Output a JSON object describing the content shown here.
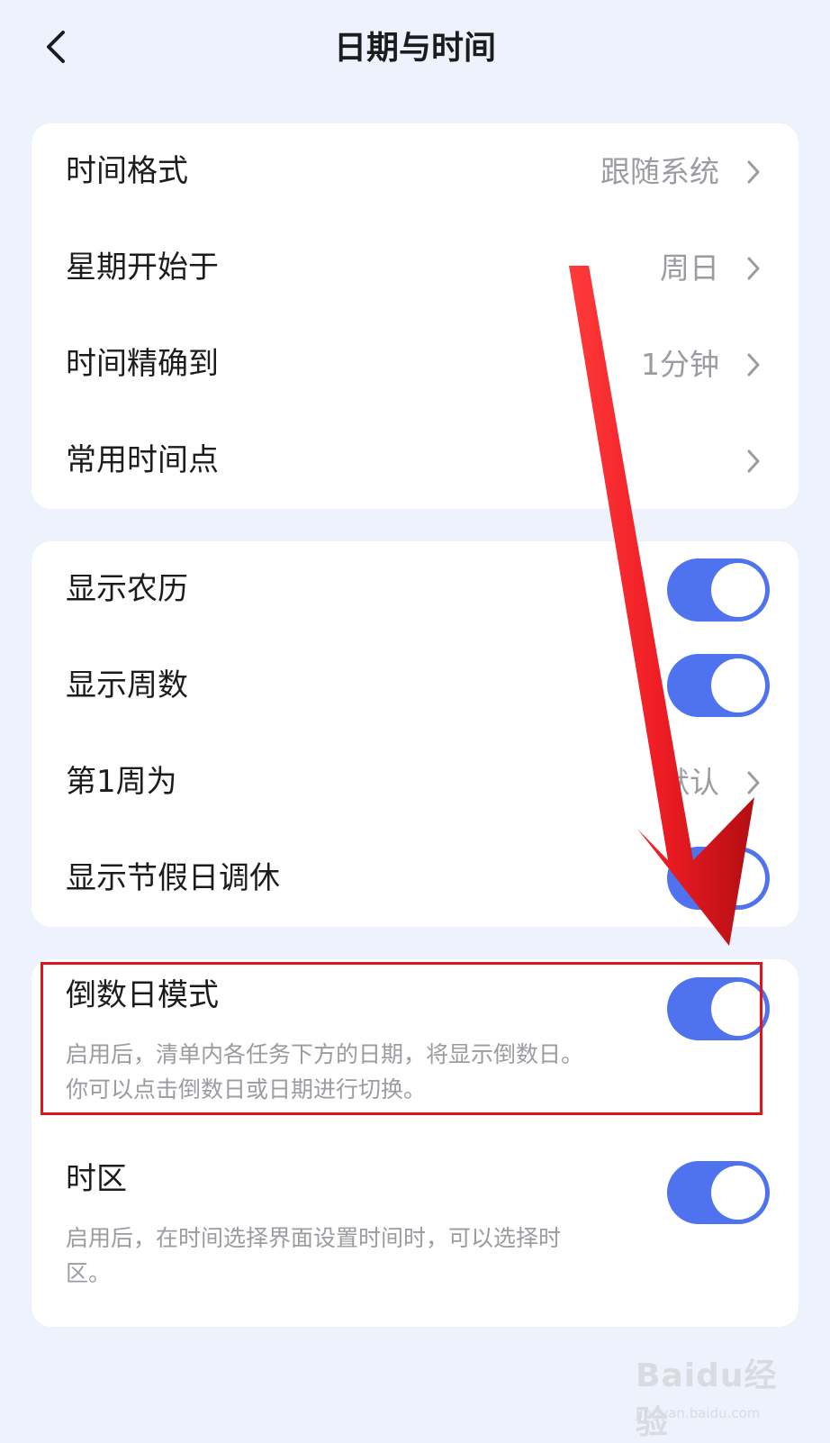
{
  "header": {
    "title": "日期与时间"
  },
  "card1": {
    "items": [
      {
        "label": "时间格式",
        "value": "跟随系统"
      },
      {
        "label": "星期开始于",
        "value": "周日"
      },
      {
        "label": "时间精确到",
        "value": "1分钟"
      },
      {
        "label": "常用时间点",
        "value": ""
      }
    ]
  },
  "card2": {
    "items": [
      {
        "label": "显示农历",
        "toggle": true
      },
      {
        "label": "显示周数",
        "toggle": true
      },
      {
        "label": "第1周为",
        "value": "默认"
      },
      {
        "label": "显示节假日调休",
        "toggle": true
      }
    ]
  },
  "card3": {
    "countdown": {
      "label": "倒数日模式",
      "toggle": true,
      "desc_line1": "启用后，清单内各任务下方的日期，将显示倒数日。",
      "desc_line2": "你可以点击倒数日或日期进行切换。"
    },
    "timezone": {
      "label": "时区",
      "toggle": true,
      "desc_line1": "启用后，在时间选择界面设置时间时，可以选择时",
      "desc_line2": "区。"
    }
  },
  "colors": {
    "accent": "#4f72ee",
    "highlight": "#e0141b",
    "arrow": "#ee1c24"
  },
  "watermark": {
    "brand": "Baidu经验",
    "url": "jingyan.baidu.com"
  }
}
